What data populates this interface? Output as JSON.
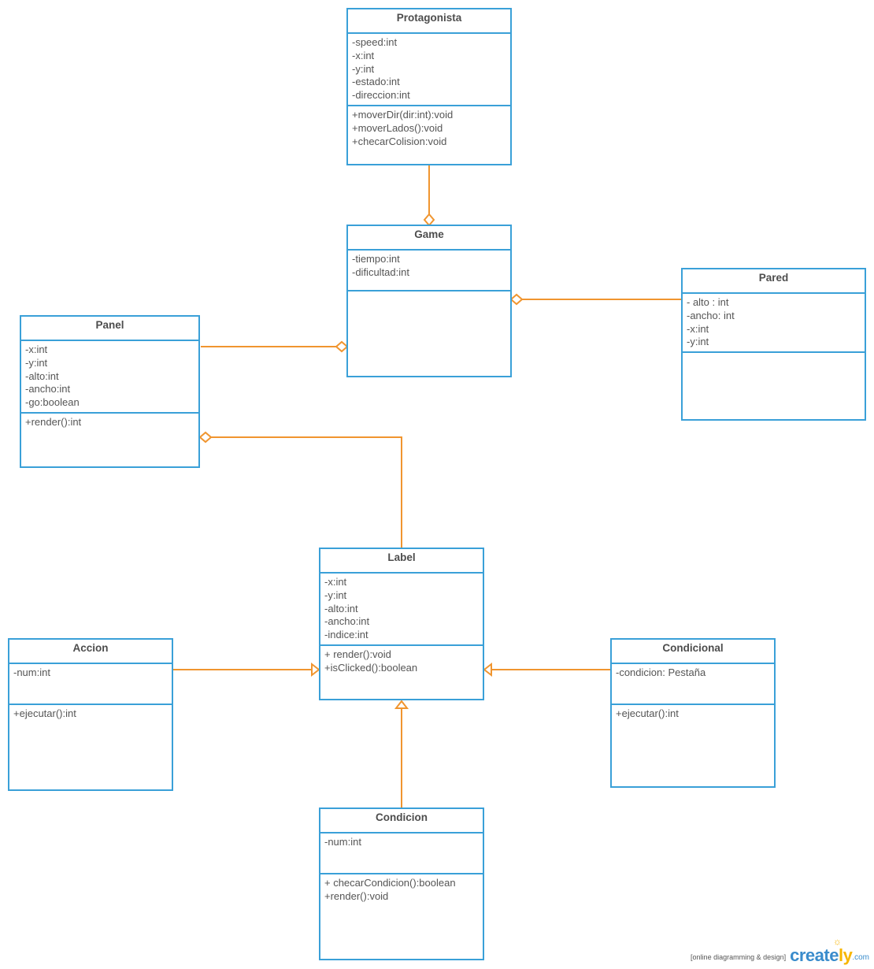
{
  "colors": {
    "box_border": "#3aa0d8",
    "connector": "#f0952f",
    "text": "#555555"
  },
  "classes": {
    "protagonista": {
      "name": "Protagonista",
      "attributes": [
        "-speed:int",
        "-x:int",
        "-y:int",
        "-estado:int",
        "-direccion:int"
      ],
      "methods": [
        "+moverDir(dir:int):void",
        "+moverLados():void",
        "+checarColision:void"
      ]
    },
    "game": {
      "name": "Game",
      "attributes": [
        "-tiempo:int",
        "-dificultad:int"
      ],
      "methods": []
    },
    "pared": {
      "name": "Pared",
      "attributes": [
        "- alto : int",
        "-ancho: int",
        "-x:int",
        "-y:int"
      ],
      "methods": []
    },
    "panel": {
      "name": "Panel",
      "attributes": [
        "-x:int",
        "-y:int",
        "-alto:int",
        "-ancho:int",
        "-go:boolean"
      ],
      "methods": [
        "+render():int"
      ]
    },
    "label": {
      "name": "Label",
      "attributes": [
        "-x:int",
        "-y:int",
        "-alto:int",
        "-ancho:int",
        "-indice:int"
      ],
      "methods": [
        "+ render():void",
        "+isClicked():boolean"
      ]
    },
    "accion": {
      "name": "Accion",
      "attributes": [
        "-num:int"
      ],
      "methods": [
        "+ejecutar():int"
      ]
    },
    "condicional": {
      "name": "Condicional",
      "attributes": [
        "-condicion: Pestaña"
      ],
      "methods": [
        "+ejecutar():int"
      ]
    },
    "condicion": {
      "name": "Condicion",
      "attributes": [
        "-num:int"
      ],
      "methods": [
        "+ checarCondicion():boolean",
        "+render():void"
      ]
    }
  },
  "relationships": [
    {
      "type": "aggregation",
      "from": "Protagonista",
      "to": "Game"
    },
    {
      "type": "aggregation",
      "from": "Panel",
      "to": "Game"
    },
    {
      "type": "aggregation",
      "from": "Pared",
      "to": "Game"
    },
    {
      "type": "aggregation",
      "from": "Label",
      "to": "Panel"
    },
    {
      "type": "generalization",
      "from": "Accion",
      "to": "Label"
    },
    {
      "type": "generalization",
      "from": "Condicional",
      "to": "Label"
    },
    {
      "type": "generalization",
      "from": "Condicion",
      "to": "Label"
    }
  ],
  "footer": {
    "tagline": "[online diagramming & design]",
    "brand_main": "create",
    "brand_accent": "ly",
    "brand_domain": ".com"
  }
}
